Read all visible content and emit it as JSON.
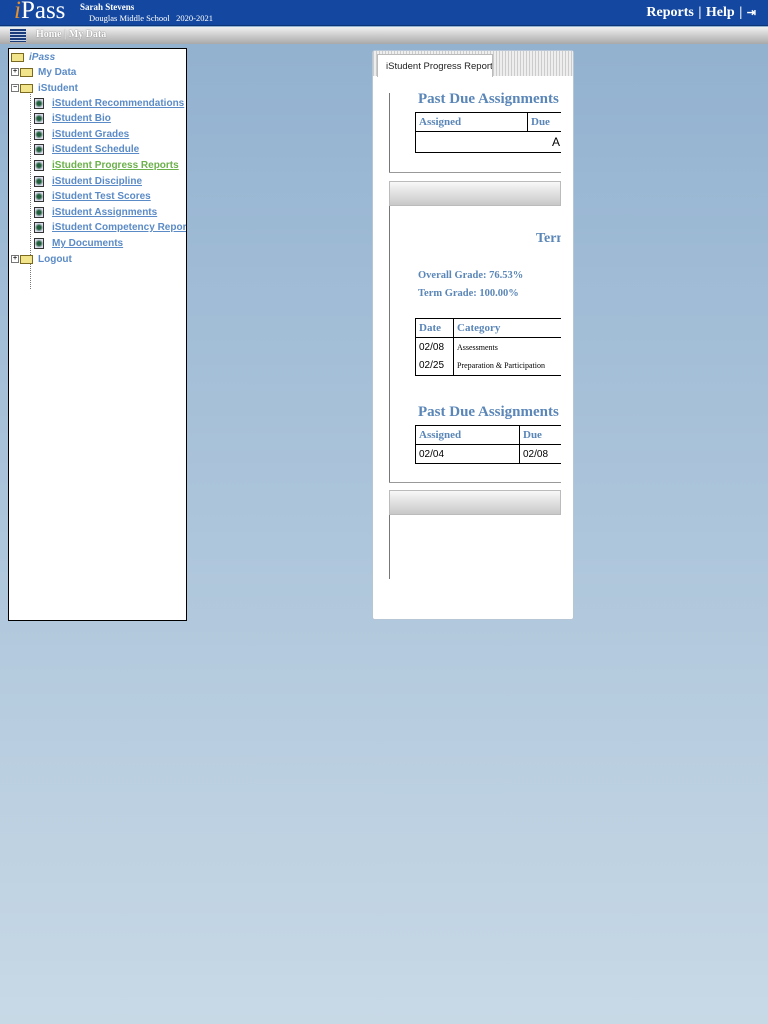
{
  "header": {
    "logo": "iPass",
    "user": "Sarah Stevens",
    "school": "Douglas Middle School",
    "year": "2020-2021",
    "links": [
      "Reports",
      "Help"
    ],
    "sep": "|",
    "logout_icon": "logout-icon",
    "brand_color": "#1448a0"
  },
  "nav": {
    "home": "Home",
    "my_data": "My Data"
  },
  "sidebar": {
    "root": "iPass",
    "my_data": "My Data",
    "istudent": "iStudent",
    "items": [
      "iStudent Recommendations",
      "iStudent Bio",
      "iStudent Grades",
      "iStudent Schedule",
      "iStudent Progress Reports",
      "iStudent Discipline",
      "iStudent Test Scores",
      "iStudent Assignments",
      "iStudent Competency Reports",
      "My Documents"
    ],
    "logout": "Logout"
  },
  "panel": {
    "tab": "iStudent Progress Reports",
    "section1": {
      "title": "Past Due Assignments",
      "headers": [
        "Assigned",
        "Due"
      ],
      "row": "A"
    },
    "section2": {
      "term_title": "Term",
      "overall": "Overall Grade: 76.53%",
      "term": "Term Grade: 100.00%",
      "headers": [
        "Date",
        "Category"
      ],
      "rows": [
        [
          "02/08",
          "Assessments"
        ],
        [
          "02/25",
          "Preparation & Participation"
        ]
      ],
      "past_due_title": "Past Due Assignments",
      "past_headers": [
        "Assigned",
        "Due"
      ],
      "past_rows": [
        [
          "02/04",
          "02/08"
        ]
      ]
    }
  }
}
